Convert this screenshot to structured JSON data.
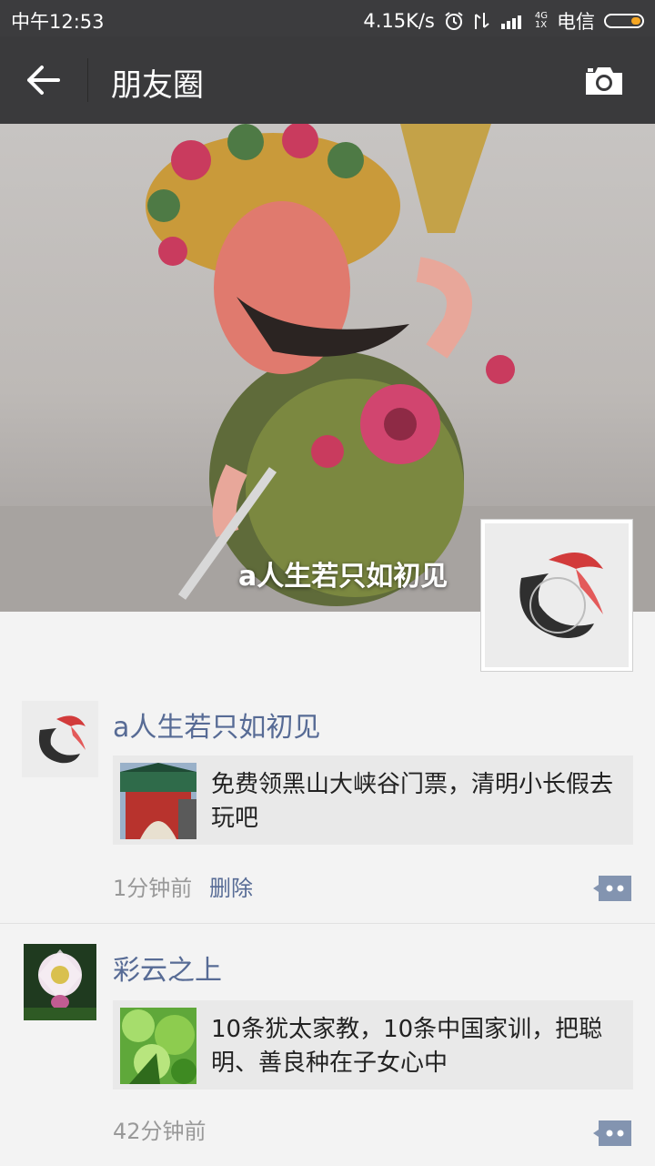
{
  "status_bar": {
    "time": "中午12:53",
    "network_speed": "4.15K/s",
    "network_type_top": "4G",
    "network_type_bottom": "1X",
    "carrier": "电信",
    "icons": [
      "alarm-icon",
      "vibrate-icon",
      "signal-icon",
      "battery-icon"
    ]
  },
  "navbar": {
    "title": "朋友圈",
    "back_icon": "back-arrow-icon",
    "camera_icon": "camera-icon"
  },
  "cover": {
    "username": "a人生若只如初见"
  },
  "posts": [
    {
      "username": "a人生若只如初见",
      "link_text": "免费领黑山大峡谷门票，清明小长假去玩吧",
      "timestamp": "1分钟前",
      "delete_label": "删除"
    },
    {
      "username": "彩云之上",
      "link_text": "10条犹太家教，10条中国家训，把聪明、善良种在子女心中",
      "timestamp": "42分钟前"
    }
  ],
  "colors": {
    "nav_bg": "#3a3a3c",
    "link_blue": "#576b95",
    "feed_bg": "#f3f3f3",
    "card_bg": "#e9e9e9"
  }
}
